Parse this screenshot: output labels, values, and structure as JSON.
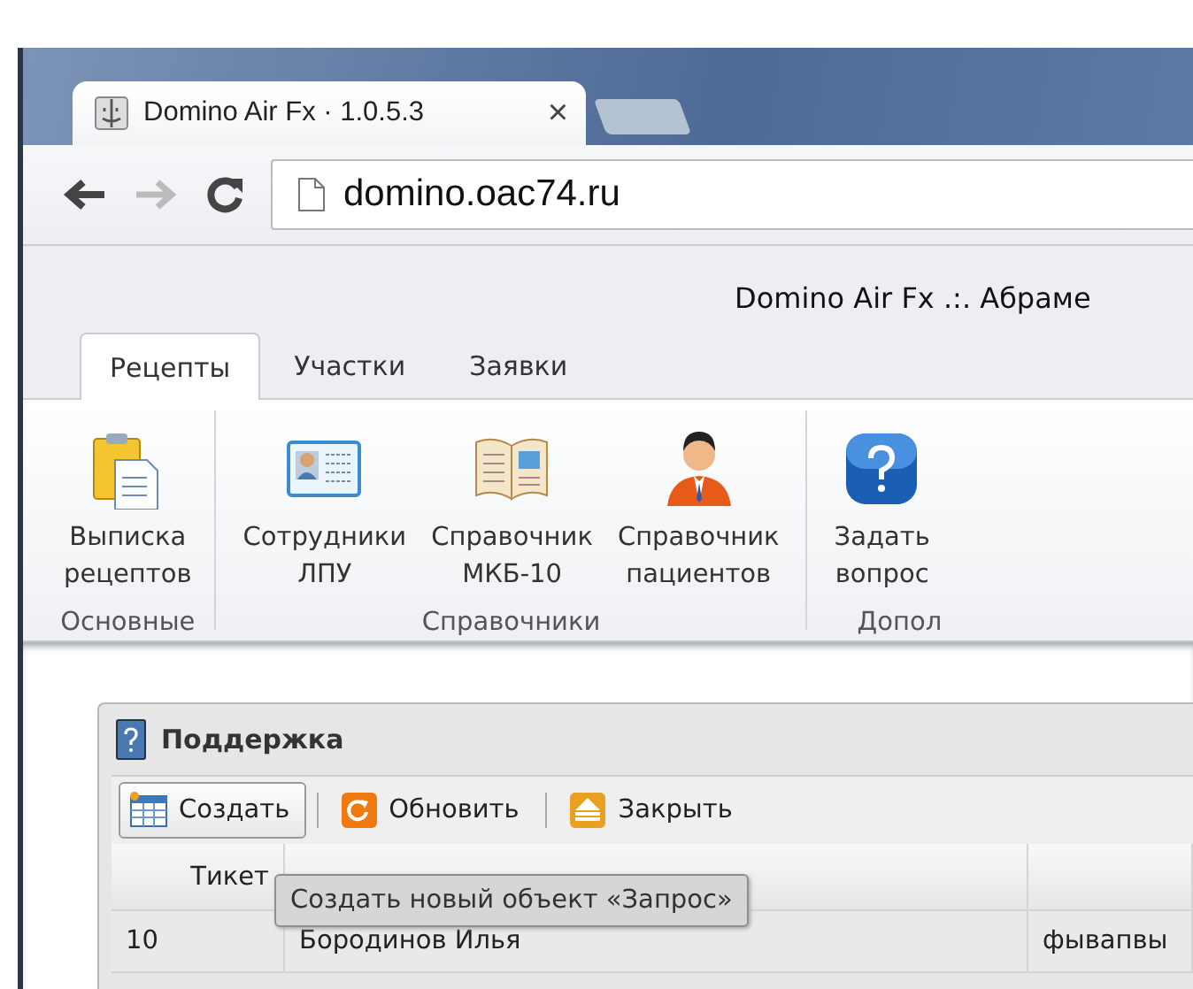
{
  "browser": {
    "tab_title": "Domino Air Fx · 1.0.5.3",
    "close": "×",
    "address": "domino.oac74.ru"
  },
  "app": {
    "title": "Domino Air Fx .:. Абраме",
    "tabs": [
      {
        "label": "Рецепты",
        "selected": true
      },
      {
        "label": "Участки",
        "selected": false
      },
      {
        "label": "Заявки",
        "selected": false
      }
    ],
    "groups": [
      {
        "label": "Основные",
        "buttons": [
          {
            "label": "Выписка рецептов"
          }
        ]
      },
      {
        "label": "Справочники",
        "buttons": [
          {
            "label": "Сотрудники ЛПУ"
          },
          {
            "label": "Справочник МКБ-10"
          },
          {
            "label": "Справочник пациентов"
          }
        ]
      },
      {
        "label": "Допол",
        "buttons": [
          {
            "label": "Задать вопрос"
          }
        ]
      }
    ]
  },
  "panel": {
    "title": "Поддержка",
    "toolbar": [
      {
        "label": "Создать",
        "hover": true
      },
      {
        "label": "Обновить",
        "hover": false
      },
      {
        "label": "Закрыть",
        "hover": false
      }
    ],
    "columns": [
      "Тикет"
    ],
    "rows": [
      [
        "10",
        "Бородинов Илья",
        "фывапвы"
      ]
    ],
    "tooltip": "Создать новый объект «Запрос»"
  }
}
